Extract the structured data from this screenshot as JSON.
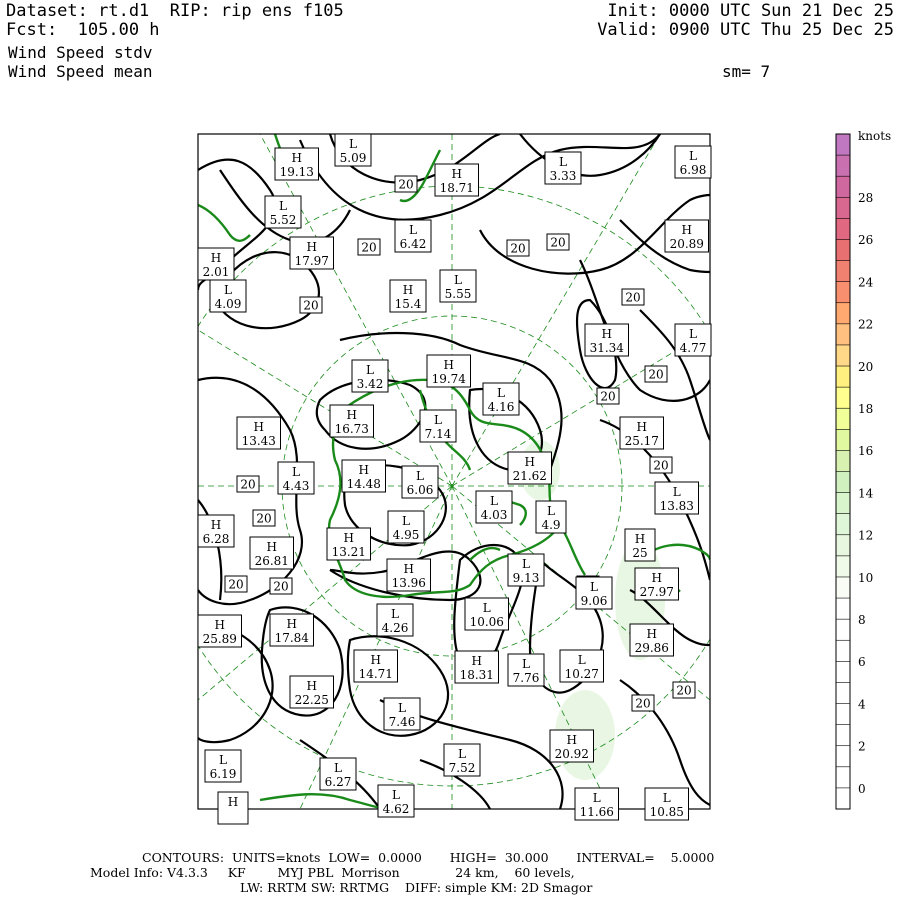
{
  "header": {
    "dataset": "Dataset: rt.d1  RIP: rip ens f105",
    "fcst": "Fcst:  105.00 h",
    "field1": "Wind Speed stdv",
    "field2": "Wind Speed mean",
    "init": "Init: 0000 UTC Sun 21 Dec 25",
    "valid": "Valid: 0900 UTC Thu 25 Dec 25",
    "sm": "sm= 7"
  },
  "colorbar": {
    "unit": "knots",
    "labels": [
      "28",
      "26",
      "24",
      "22",
      "20",
      "18",
      "16",
      "14",
      "12",
      "10",
      "8",
      "6",
      "4",
      "2",
      "0"
    ],
    "colors": [
      "#c078c0",
      "#c870b0",
      "#d068a0",
      "#d86890",
      "#e06880",
      "#e87070",
      "#f08070",
      "#f89070",
      "#ffa870",
      "#ffc080",
      "#ffd888",
      "#fff080",
      "#ffff90",
      "#f0ff98",
      "#e0f8a0",
      "#d8f0b0",
      "#d0f0c0",
      "#d8f4cc",
      "#e0f6d8",
      "#e8f8e0",
      "#f0fae8",
      "#f8fcf4",
      "#ffffff",
      "#ffffff",
      "#ffffff",
      "#ffffff",
      "#ffffff",
      "#ffffff",
      "#ffffff",
      "#ffffff",
      "#ffffff",
      "#ffffff"
    ]
  },
  "map": {
    "boxes": [
      {
        "t": "L",
        "v": "5.09"
      },
      {
        "t": "H",
        "v": "19.13"
      },
      {
        "t": "H",
        "v": "18.71"
      },
      {
        "t": "L",
        "v": "3.33"
      },
      {
        "t": "L",
        "v": "6.98"
      },
      {
        "t": "L",
        "v": "5.52"
      },
      {
        "t": "L",
        "v": "6.42"
      },
      {
        "t": "H",
        "v": "20.89"
      },
      {
        "t": "H",
        "v": "2.01"
      },
      {
        "t": "H",
        "v": "17.97"
      },
      {
        "t": "L",
        "v": "4.09"
      },
      {
        "t": "H",
        "v": "15.4"
      },
      {
        "t": "L",
        "v": "5.55"
      },
      {
        "t": "H",
        "v": "31.34"
      },
      {
        "t": "L",
        "v": "4.77"
      },
      {
        "t": "H",
        "v": "19.74"
      },
      {
        "t": "L",
        "v": "3.42"
      },
      {
        "t": "L",
        "v": "4.16"
      },
      {
        "t": "H",
        "v": "16.73"
      },
      {
        "t": "H",
        "v": "13.43"
      },
      {
        "t": "L",
        "v": "7.14"
      },
      {
        "t": "H",
        "v": "25.17"
      },
      {
        "t": "L",
        "v": "4.43"
      },
      {
        "t": "H",
        "v": "14.48"
      },
      {
        "t": "L",
        "v": "6.06"
      },
      {
        "t": "H",
        "v": "21.62"
      },
      {
        "t": "L",
        "v": "13.83"
      },
      {
        "t": "L",
        "v": "4.03"
      },
      {
        "t": "L",
        "v": "4.9"
      },
      {
        "t": "H",
        "v": "6.28"
      },
      {
        "t": "L",
        "v": "4.95"
      },
      {
        "t": "H",
        "v": "26.81"
      },
      {
        "t": "H",
        "v": "13.21"
      },
      {
        "t": "H",
        "v": "25"
      },
      {
        "t": "H",
        "v": "13.96"
      },
      {
        "t": "L",
        "v": "9.13"
      },
      {
        "t": "L",
        "v": "9.06"
      },
      {
        "t": "H",
        "v": "27.97"
      },
      {
        "t": "L",
        "v": "10.06"
      },
      {
        "t": "H",
        "v": "25.89"
      },
      {
        "t": "H",
        "v": "17.84"
      },
      {
        "t": "L",
        "v": "4.26"
      },
      {
        "t": "H",
        "v": "29.86"
      },
      {
        "t": "H",
        "v": "14.71"
      },
      {
        "t": "H",
        "v": "18.31"
      },
      {
        "t": "L",
        "v": "7.76"
      },
      {
        "t": "L",
        "v": "10.27"
      },
      {
        "t": "H",
        "v": "22.25"
      },
      {
        "t": "L",
        "v": "7.46"
      },
      {
        "t": "H",
        "v": "20.92"
      },
      {
        "t": "L",
        "v": "6.19"
      },
      {
        "t": "L",
        "v": "6.27"
      },
      {
        "t": "L",
        "v": "7.52"
      },
      {
        "t": "L",
        "v": "4.62"
      },
      {
        "t": "H",
        "v": ""
      },
      {
        "t": "L",
        "v": "11.66"
      },
      {
        "t": "L",
        "v": "10.85"
      }
    ],
    "contour_label": "20"
  },
  "footer": {
    "line1": "CONTOURS:  UNITS=knots  LOW=  0.0000       HIGH=  30.000       INTERVAL=    5.0000",
    "line2": "Model Info: V4.3.3     KF        MYJ PBL  Morrison              24 km,    60 levels,",
    "line3": "LW: RRTM SW: RRTMG    DIFF: simple KM: 2D Smagor"
  }
}
